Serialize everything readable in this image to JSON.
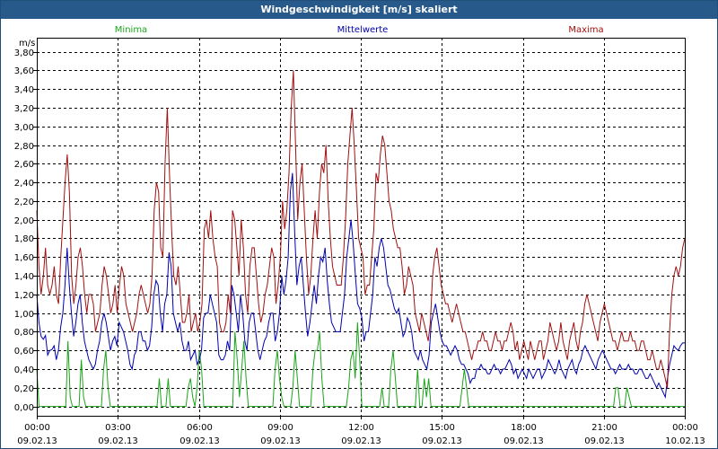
{
  "window": {
    "title": "Windgeschwindigkeit [m/s] skaliert"
  },
  "colors": {
    "min": "#1aa51a",
    "mean": "#0000b0",
    "max": "#a01010",
    "grid": "#000000",
    "bg": "#ffffff",
    "title_bg": "#27598b"
  },
  "chart_data": {
    "type": "line",
    "title": "Windgeschwindigkeit [m/s] skaliert",
    "ylabel": "m/s",
    "xlabel": "",
    "ylim": [
      -0.1,
      3.95
    ],
    "xlim_hours": [
      0,
      24
    ],
    "yticks": [
      "0,00",
      "0,20",
      "0,40",
      "0,60",
      "0,80",
      "1,00",
      "1,20",
      "1,40",
      "1,60",
      "1,80",
      "2,00",
      "2,20",
      "2,40",
      "2,60",
      "2,80",
      "3,00",
      "3,20",
      "3,40",
      "3,60",
      "3,80"
    ],
    "xticks": [
      {
        "time": "00:00",
        "date": "09.02.13"
      },
      {
        "time": "03:00",
        "date": "09.02.13"
      },
      {
        "time": "06:00",
        "date": "09.02.13"
      },
      {
        "time": "09:00",
        "date": "09.02.13"
      },
      {
        "time": "12:00",
        "date": "09.02.13"
      },
      {
        "time": "15:00",
        "date": "09.02.13"
      },
      {
        "time": "18:00",
        "date": "09.02.13"
      },
      {
        "time": "21:00",
        "date": "09.02.13"
      },
      {
        "time": "00:00",
        "date": "10.02.13"
      }
    ],
    "grid": true,
    "legend_placement": "top",
    "series": [
      {
        "name": "Minima",
        "values": [
          0.4,
          0.0,
          0.0,
          0.0,
          0.0,
          0.0,
          0.0,
          0.0,
          0.0,
          0.0,
          0.0,
          0.0,
          0.0,
          0.0,
          0.7,
          0.1,
          0.0,
          0.0,
          0.0,
          0.0,
          0.5,
          0.1,
          0.0,
          0.0,
          0.0,
          0.0,
          0.0,
          0.0,
          0.0,
          0.0,
          0.4,
          0.6,
          0.2,
          0.0,
          0.0,
          0.0,
          0.0,
          0.0,
          0.0,
          0.0,
          0.0,
          0.0,
          0.0,
          0.0,
          0.0,
          0.0,
          0.0,
          0.0,
          0.0,
          0.0,
          0.0,
          0.0,
          0.0,
          0.0,
          0.0,
          0.3,
          0.0,
          0.0,
          0.0,
          0.3,
          0.0,
          0.0,
          0.0,
          0.0,
          0.0,
          0.0,
          0.0,
          0.0,
          0.2,
          0.3,
          0.1,
          0.0,
          0.2,
          0.6,
          0.4,
          0.0,
          0.0,
          0.0,
          0.0,
          0.0,
          0.0,
          0.0,
          0.0,
          0.0,
          0.0,
          0.0,
          0.0,
          0.0,
          0.0,
          0.8,
          0.5,
          0.1,
          0.4,
          0.7,
          0.3,
          0.0,
          0.0,
          0.0,
          0.0,
          0.0,
          0.0,
          0.0,
          0.0,
          0.0,
          0.0,
          0.0,
          0.0,
          0.4,
          0.6,
          0.3,
          0.1,
          0.0,
          0.0,
          0.0,
          0.0,
          0.2,
          0.6,
          0.3,
          0.0,
          0.0,
          0.0,
          0.0,
          0.0,
          0.0,
          0.4,
          0.6,
          0.6,
          0.8,
          0.3,
          0.0,
          0.0,
          0.0,
          0.0,
          0.0,
          0.0,
          0.0,
          0.0,
          0.0,
          0.0,
          0.0,
          0.2,
          0.5,
          0.6,
          0.3,
          0.9,
          0.5,
          0.0,
          0.0,
          0.0,
          0.0,
          0.0,
          0.0,
          0.0,
          0.0,
          0.0,
          0.2,
          0.0,
          0.0,
          0.0,
          0.4,
          0.6,
          0.3,
          0.0,
          0.0,
          0.0,
          0.0,
          0.0,
          0.0,
          0.0,
          0.0,
          0.0,
          0.4,
          0.0,
          0.0,
          0.3,
          0.1,
          0.3,
          0.0,
          0.0,
          0.0,
          0.0,
          0.0,
          0.0,
          0.0,
          0.0,
          0.0,
          0.0,
          0.0,
          0.0,
          0.0,
          0.0,
          0.2,
          0.4,
          0.2,
          0.0,
          0.0,
          0.0,
          0.0,
          0.0,
          0.0,
          0.0,
          0.0,
          0.0,
          0.0,
          0.0,
          0.0,
          0.0,
          0.0,
          0.0,
          0.0,
          0.0,
          0.0,
          0.0,
          0.0,
          0.0,
          0.0,
          0.0,
          0.0,
          0.0,
          0.0,
          0.0,
          0.0,
          0.0,
          0.0,
          0.0,
          0.0,
          0.0,
          0.0,
          0.0,
          0.0,
          0.0,
          0.0,
          0.0,
          0.0,
          0.0,
          0.0,
          0.0,
          0.0,
          0.0,
          0.0,
          0.0,
          0.0,
          0.0,
          0.0,
          0.0,
          0.0,
          0.0,
          0.0,
          0.0,
          0.0,
          0.0,
          0.0,
          0.0,
          0.0,
          0.0,
          0.0,
          0.0,
          0.0,
          0.0,
          0.0,
          0.2,
          0.2,
          0.0,
          0.0,
          0.0,
          0.2,
          0.1,
          0.0,
          0.0,
          0.0,
          0.0,
          0.0,
          0.0,
          0.0,
          0.0,
          0.0,
          0.0,
          0.0,
          0.0,
          0.0,
          0.0,
          0.0,
          0.0,
          0.0,
          0.0,
          0.0,
          0.0,
          0.0,
          0.0,
          0.0,
          0.0,
          0.0
        ]
      },
      {
        "name": "Mittelwerte",
        "values": [
          1.2,
          0.9,
          0.75,
          0.72,
          0.76,
          0.55,
          0.6,
          0.61,
          0.65,
          0.5,
          0.6,
          0.85,
          1.0,
          1.3,
          1.7,
          1.3,
          1.0,
          0.75,
          0.9,
          1.1,
          1.2,
          0.9,
          0.7,
          0.6,
          0.5,
          0.45,
          0.4,
          0.45,
          0.6,
          0.7,
          0.9,
          1.0,
          0.9,
          0.75,
          0.6,
          0.7,
          0.75,
          0.65,
          0.9,
          0.85,
          0.8,
          0.7,
          0.6,
          0.45,
          0.4,
          0.55,
          0.6,
          0.8,
          0.8,
          0.7,
          0.7,
          0.6,
          0.65,
          0.85,
          1.2,
          1.35,
          1.3,
          1.0,
          0.8,
          1.1,
          1.2,
          1.65,
          1.5,
          1.0,
          0.9,
          0.8,
          0.9,
          0.7,
          0.6,
          0.6,
          0.7,
          0.5,
          0.55,
          0.6,
          0.45,
          0.5,
          0.6,
          0.95,
          1.0,
          1.0,
          1.2,
          1.1,
          1.0,
          0.9,
          0.55,
          0.5,
          0.5,
          0.55,
          0.7,
          0.6,
          1.3,
          1.2,
          1.0,
          0.8,
          1.2,
          1.0,
          0.7,
          0.6,
          0.9,
          1.0,
          1.0,
          0.8,
          0.6,
          0.5,
          0.6,
          0.7,
          0.75,
          0.9,
          1.0,
          1.0,
          0.7,
          0.8,
          1.0,
          1.4,
          1.2,
          1.35,
          1.6,
          2.3,
          2.5,
          1.85,
          1.3,
          1.5,
          1.6,
          1.3,
          1.0,
          0.75,
          0.9,
          1.1,
          1.3,
          1.1,
          1.4,
          1.6,
          1.55,
          1.7,
          1.35,
          1.1,
          0.9,
          0.85,
          0.8,
          0.8,
          0.8,
          1.0,
          1.2,
          1.6,
          1.8,
          2.0,
          1.75,
          1.4,
          1.1,
          1.05,
          0.95,
          0.7,
          0.8,
          0.8,
          1.0,
          1.2,
          1.6,
          1.5,
          1.7,
          1.8,
          1.7,
          1.5,
          1.3,
          1.25,
          1.15,
          1.05,
          1.0,
          1.05,
          0.9,
          0.75,
          0.8,
          0.95,
          0.9,
          0.8,
          0.6,
          0.55,
          0.5,
          0.6,
          0.5,
          0.45,
          0.4,
          0.55,
          0.9,
          1.0,
          1.1,
          0.95,
          0.8,
          0.7,
          0.65,
          0.65,
          0.6,
          0.55,
          0.6,
          0.65,
          0.6,
          0.5,
          0.45,
          0.45,
          0.4,
          0.35,
          0.25,
          0.3,
          0.3,
          0.4,
          0.4,
          0.45,
          0.4,
          0.4,
          0.35,
          0.35,
          0.4,
          0.45,
          0.4,
          0.4,
          0.35,
          0.4,
          0.4,
          0.45,
          0.5,
          0.45,
          0.35,
          0.4,
          0.3,
          0.35,
          0.4,
          0.35,
          0.3,
          0.4,
          0.35,
          0.3,
          0.35,
          0.4,
          0.4,
          0.3,
          0.35,
          0.4,
          0.5,
          0.45,
          0.4,
          0.35,
          0.4,
          0.5,
          0.4,
          0.35,
          0.3,
          0.4,
          0.45,
          0.5,
          0.4,
          0.35,
          0.45,
          0.5,
          0.6,
          0.65,
          0.6,
          0.55,
          0.5,
          0.45,
          0.4,
          0.5,
          0.55,
          0.6,
          0.55,
          0.5,
          0.45,
          0.4,
          0.4,
          0.35,
          0.4,
          0.45,
          0.4,
          0.4,
          0.4,
          0.45,
          0.4,
          0.4,
          0.35,
          0.35,
          0.4,
          0.4,
          0.35,
          0.3,
          0.3,
          0.35,
          0.3,
          0.25,
          0.2,
          0.25,
          0.2,
          0.15,
          0.1,
          0.3,
          0.45,
          0.55,
          0.65,
          0.62,
          0.6,
          0.65,
          0.68,
          0.68
        ]
      },
      {
        "name": "Maxima",
        "values": [
          2.1,
          1.5,
          1.2,
          1.4,
          1.7,
          1.3,
          1.2,
          1.3,
          1.5,
          1.2,
          1.1,
          1.6,
          2.0,
          2.4,
          2.7,
          2.3,
          1.4,
          1.1,
          1.3,
          1.6,
          1.7,
          1.5,
          1.2,
          1.0,
          1.2,
          1.2,
          1.1,
          0.8,
          0.9,
          1.0,
          1.3,
          1.5,
          1.4,
          1.2,
          1.0,
          1.1,
          1.3,
          1.0,
          1.3,
          1.5,
          1.4,
          1.1,
          1.0,
          0.9,
          0.8,
          0.9,
          1.0,
          1.2,
          1.3,
          1.2,
          1.1,
          1.0,
          1.1,
          1.4,
          2.1,
          2.4,
          2.3,
          1.7,
          1.6,
          2.6,
          3.2,
          2.5,
          1.9,
          1.4,
          1.3,
          1.5,
          1.2,
          0.9,
          0.9,
          1.0,
          1.2,
          0.8,
          0.9,
          1.0,
          0.8,
          0.9,
          1.1,
          1.9,
          2.0,
          1.8,
          2.1,
          1.8,
          1.6,
          1.5,
          0.9,
          0.8,
          0.8,
          0.9,
          1.2,
          1.0,
          2.1,
          2.0,
          1.7,
          1.4,
          2.0,
          1.7,
          1.2,
          1.0,
          1.5,
          1.7,
          1.7,
          1.4,
          1.1,
          0.9,
          1.0,
          1.2,
          1.3,
          1.5,
          1.7,
          1.6,
          1.1,
          1.3,
          1.6,
          2.2,
          1.9,
          2.1,
          2.5,
          3.2,
          3.6,
          2.8,
          2.0,
          2.4,
          2.6,
          2.1,
          1.6,
          1.2,
          1.4,
          1.8,
          2.1,
          1.8,
          2.3,
          2.6,
          2.5,
          2.8,
          2.2,
          1.8,
          1.5,
          1.4,
          1.3,
          1.3,
          1.3,
          1.6,
          2.0,
          2.6,
          2.9,
          3.2,
          2.8,
          2.3,
          1.8,
          1.7,
          1.6,
          1.2,
          1.3,
          1.3,
          1.6,
          1.9,
          2.5,
          2.4,
          2.7,
          2.9,
          2.8,
          2.5,
          2.2,
          2.1,
          1.9,
          1.8,
          1.7,
          1.7,
          1.5,
          1.2,
          1.3,
          1.5,
          1.4,
          1.3,
          1.0,
          0.9,
          0.8,
          1.0,
          0.9,
          0.8,
          0.7,
          0.9,
          1.4,
          1.6,
          1.7,
          1.5,
          1.3,
          1.2,
          1.1,
          1.1,
          1.0,
          0.9,
          1.0,
          1.1,
          1.0,
          0.9,
          0.8,
          0.8,
          0.7,
          0.6,
          0.5,
          0.6,
          0.6,
          0.7,
          0.7,
          0.8,
          0.7,
          0.7,
          0.6,
          0.6,
          0.7,
          0.8,
          0.7,
          0.7,
          0.6,
          0.7,
          0.7,
          0.8,
          0.9,
          0.8,
          0.6,
          0.7,
          0.5,
          0.6,
          0.7,
          0.6,
          0.5,
          0.7,
          0.6,
          0.5,
          0.6,
          0.7,
          0.7,
          0.5,
          0.6,
          0.7,
          0.9,
          0.8,
          0.7,
          0.6,
          0.7,
          0.9,
          0.7,
          0.6,
          0.5,
          0.7,
          0.8,
          0.9,
          0.7,
          0.6,
          0.8,
          0.9,
          1.1,
          1.2,
          1.1,
          1.0,
          0.9,
          0.8,
          0.7,
          0.9,
          1.0,
          1.1,
          1.0,
          0.9,
          0.8,
          0.7,
          0.7,
          0.6,
          0.7,
          0.8,
          0.7,
          0.7,
          0.7,
          0.8,
          0.7,
          0.7,
          0.6,
          0.6,
          0.7,
          0.7,
          0.6,
          0.5,
          0.5,
          0.6,
          0.5,
          0.4,
          0.4,
          0.5,
          0.4,
          0.3,
          0.2,
          0.8,
          1.2,
          1.4,
          1.5,
          1.4,
          1.5,
          1.7,
          1.8
        ]
      }
    ]
  }
}
